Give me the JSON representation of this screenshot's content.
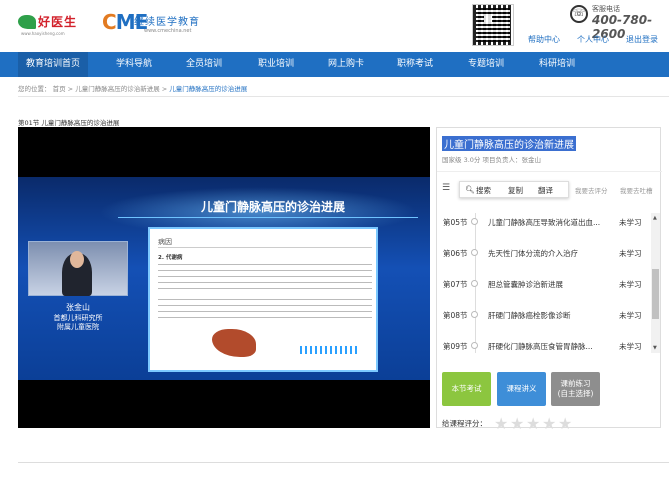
{
  "header": {
    "logo1_name": "好医生",
    "logo1_url": "www.haoyisheng.com",
    "logo2_brand": [
      "C",
      "M",
      "E"
    ],
    "logo2_name": "继续医学教育",
    "logo2_url": "www.cmechina.net",
    "hotline_label": "客服电话",
    "hotline_number": "400-780-2600",
    "links": [
      "帮助中心",
      "个人中心",
      "退出登录"
    ]
  },
  "nav": {
    "items": [
      "教育培训首页",
      "学科导航",
      "全员培训",
      "职业培训",
      "网上购卡",
      "职称考试",
      "专题培训",
      "科研培训"
    ]
  },
  "breadcrumb": {
    "prefix": "您的位置：",
    "home": "首页",
    "parent": "儿童门静脉高压的诊治新进展",
    "current": "儿童门静脉高压的诊治进展",
    "sep": ">"
  },
  "section_title": "第01节 儿童门静脉高压的诊治进展",
  "video": {
    "slide_title": "儿童门静脉高压的诊治进展",
    "box_heading": "病因",
    "box_sub": "2. 代谢病",
    "speaker_name": "张金山",
    "speaker_org1": "首都儿科研究所",
    "speaker_org2": "附属儿童医院"
  },
  "course": {
    "title": "儿童门静脉高压的诊治新进展",
    "meta": "国家级 3.0分 项目负责人：张金山",
    "toolbar_list_label": "目录",
    "popup": [
      "搜索",
      "复制",
      "翻译"
    ],
    "rate_label": "我要去评分",
    "note_label": "我要去吐槽",
    "lessons": [
      {
        "num": "第05节",
        "name": "儿童门静脉高压导致消化道出血...",
        "status": "未学习"
      },
      {
        "num": "第06节",
        "name": "先天性门体分流的介入治疗",
        "status": "未学习"
      },
      {
        "num": "第07节",
        "name": "胆总管囊肿诊治新进展",
        "status": "未学习"
      },
      {
        "num": "第08节",
        "name": "肝硬门静脉癌栓影像诊断",
        "status": "未学习"
      },
      {
        "num": "第09节",
        "name": "肝硬化门静脉高压食管胃静脉...",
        "status": "未学习"
      }
    ],
    "buttons": {
      "exam": "本节考试",
      "handout": "课程讲义",
      "practice_line1": "课前练习",
      "practice_line2": "(自主选择)"
    },
    "rating_label": "给课程评分："
  }
}
